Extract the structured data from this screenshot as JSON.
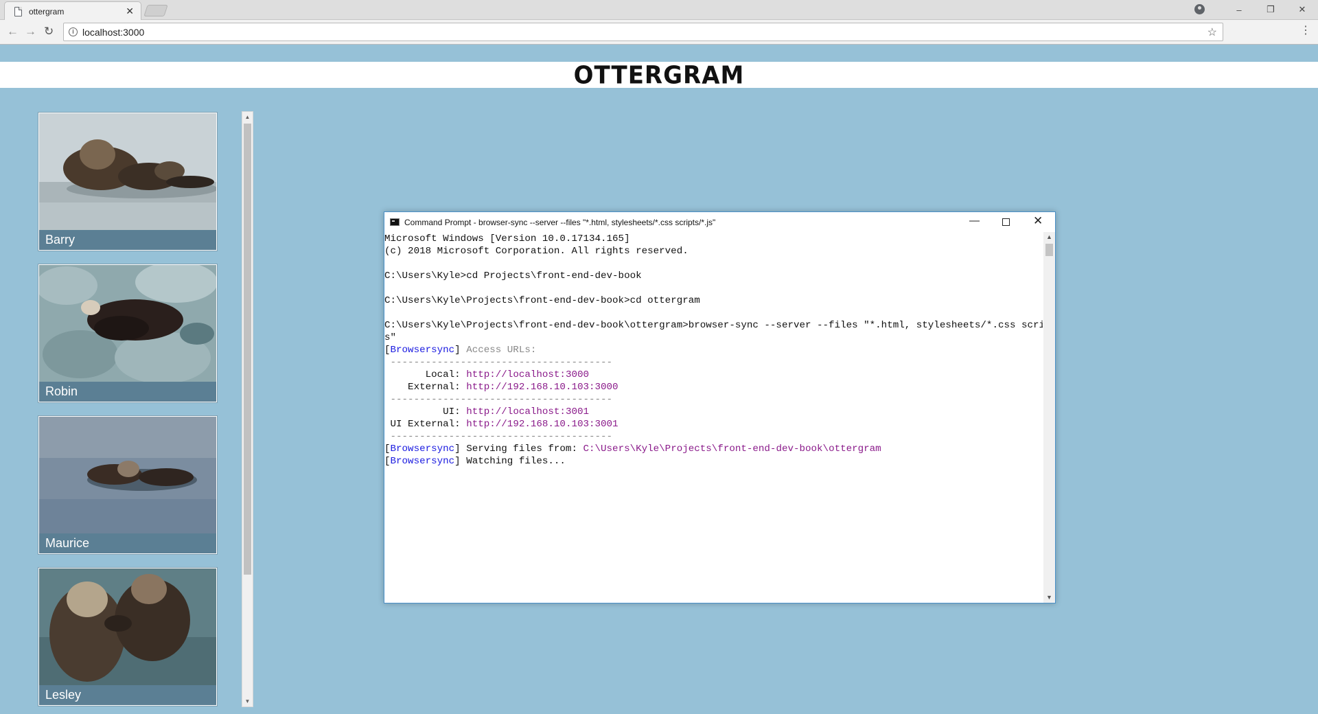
{
  "browser": {
    "tab_title": "ottergram",
    "tab_close": "✕",
    "url": "localhost:3000",
    "window_controls": [
      "–",
      "❐",
      "✕"
    ]
  },
  "page": {
    "logo": "OTTERGRAM",
    "thumbnails": [
      {
        "name": "Barry"
      },
      {
        "name": "Robin"
      },
      {
        "name": "Maurice"
      },
      {
        "name": "Lesley"
      }
    ]
  },
  "cmd": {
    "title": "Command Prompt - browser-sync  --server --files \"*.html, stylesheets/*.css scripts/*.js\"",
    "lines": {
      "l1": "Microsoft Windows [Version 10.0.17134.165]",
      "l2": "(c) 2018 Microsoft Corporation. All rights reserved.",
      "l3": "C:\\Users\\Kyle>cd Projects\\front-end-dev-book",
      "l4": "C:\\Users\\Kyle\\Projects\\front-end-dev-book>cd ottergram",
      "l5": "C:\\Users\\Kyle\\Projects\\front-end-dev-book\\ottergram>browser-sync --server --files \"*.html, stylesheets/*.css scripts/*.j",
      "l6": "s\"",
      "bs_tag": "Browsersync",
      "access_urls": " Access URLs:",
      "dashes": " --------------------------------------",
      "local_label": "       Local: ",
      "local_url": "http://localhost:3000",
      "external_label": "    External: ",
      "external_url": "http://192.168.10.103:3000",
      "ui_label": "          UI: ",
      "ui_url": "http://localhost:3001",
      "ui_external_label": " UI External: ",
      "ui_external_url": "http://192.168.10.103:3001",
      "serving": " Serving files from: ",
      "serving_path": "C:\\Users\\Kyle\\Projects\\front-end-dev-book\\ottergram",
      "watching": " Watching files..."
    }
  }
}
